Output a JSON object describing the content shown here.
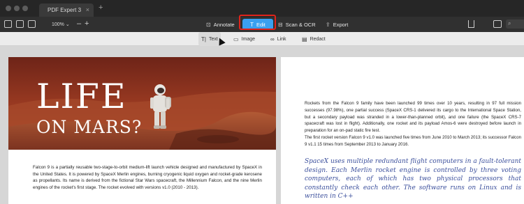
{
  "window": {
    "tab_title": "PDF Expert 3",
    "tab_close": "×",
    "new_tab": "+"
  },
  "toolbar": {
    "zoom": "100%",
    "zoom_down": "⌄",
    "zoom_minus": "–",
    "zoom_plus": "+",
    "annotate": "Annotate",
    "edit": "Edit",
    "scan_ocr": "Scan & OCR",
    "export": "Export",
    "annotate_icon": "annotate-icon",
    "edit_icon": "text-cursor-icon",
    "scan_icon": "scan-icon",
    "export_icon": "export-icon",
    "highlight_color": "#e0231b",
    "accent_color": "#3aa0f0"
  },
  "edit_tools": {
    "text": "Text",
    "image": "Image",
    "link": "Link",
    "redact": "Redact"
  },
  "page_left": {
    "headline_line1": "LIFE",
    "headline_line2": "ON MARS?",
    "body": "Falcon 9 is a partially reusable two-stage-to-orbit medium-lift launch vehicle designed and manufactured by SpaceX in the United States. It is powered by SpaceX Merlin engines, burning cryogenic liquid oxygen and rocket-grade kerosene as propellants. Its name is derived from the fictional Star Wars spacecraft, the Millennium Falcon, and the nine Merlin engines of the rocket's first stage. The rocket evolved with versions v1.0 (2010 - 2013)."
  },
  "page_right": {
    "paragraph1": "Rockets from the Falcon 9 family have been launched 99 times over 10 years, resulting in 97 full mission successes (97.98%), one partial success (SpaceX CRS-1 delivered its cargo to the International Space Station, but a secondary payload was stranded in a lower-than-planned orbit), and one failure (the SpaceX CRS-7 spacecraft was lost in flight). Additionally, one rocket and its payload Amos-6 were destroyed before launch in preparation for an on-pad static fire test.",
    "paragraph2": "The first rocket version Falcon 9 v1.0 was launched five times from June 2010 to March 2013; its successor Falcon 9 v1.1 15 times from September 2013 to January 2016.",
    "handwritten": "SpaceX uses multiple redundant flight computers in a fault-tolerant design. Each Merlin rocket engine is controlled by three voting computers, each of which has two physical processors that constantly check each other. The software runs on Linux and is written in C++"
  }
}
